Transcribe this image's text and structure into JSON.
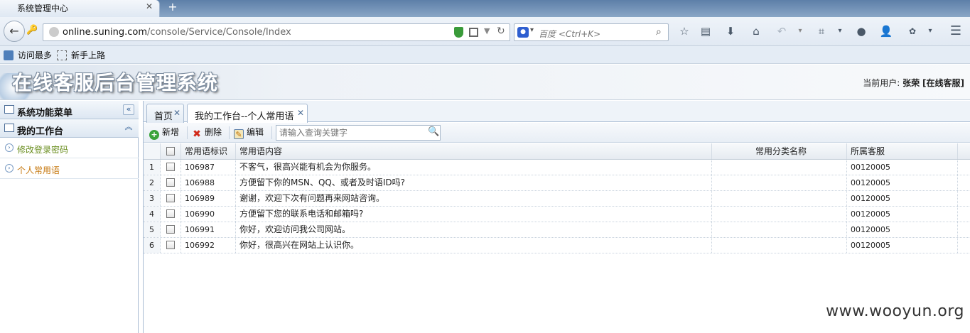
{
  "browser": {
    "tab_title": "系统管理中心",
    "url_domain": "online.suning.com",
    "url_path": "/console/Service/Console/Index",
    "search_placeholder": "百度 <Ctrl+K>"
  },
  "bookmarks": [
    {
      "label": "访问最多"
    },
    {
      "label": "新手上路"
    }
  ],
  "header": {
    "title": "在线客服后台管理系统",
    "user_label": "当前用户:",
    "user_name": "张荣",
    "user_role": "[在线客服]"
  },
  "sidebar": {
    "menu_title": "系统功能菜单",
    "group_title": "我的工作台",
    "items": [
      {
        "label": "修改登录密码",
        "color": "#6a8e1f"
      },
      {
        "label": "个人常用语",
        "color": "#c77a12"
      }
    ]
  },
  "tabs": [
    {
      "label": "首页"
    },
    {
      "label": "我的工作台--个人常用语"
    }
  ],
  "toolbar": {
    "add_label": "新增",
    "delete_label": "删除",
    "edit_label": "编辑",
    "query_placeholder": "请输入查询关键字"
  },
  "grid": {
    "columns": [
      "常用语标识",
      "常用语内容",
      "常用分类名称",
      "所属客服"
    ],
    "rows": [
      {
        "no": "1",
        "id": "106987",
        "content": "不客气，很高兴能有机会为你服务。",
        "category": "",
        "agent": "00120005"
      },
      {
        "no": "2",
        "id": "106988",
        "content": "方便留下你的MSN、QQ、或者及时语ID吗?",
        "category": "",
        "agent": "00120005"
      },
      {
        "no": "3",
        "id": "106989",
        "content": "谢谢，欢迎下次有问题再来网站咨询。",
        "category": "",
        "agent": "00120005"
      },
      {
        "no": "4",
        "id": "106990",
        "content": "方便留下您的联系电话和邮箱吗?",
        "category": "",
        "agent": "00120005"
      },
      {
        "no": "5",
        "id": "106991",
        "content": "你好，欢迎访问我公司网站。",
        "category": "",
        "agent": "00120005"
      },
      {
        "no": "6",
        "id": "106992",
        "content": "你好，很高兴在网站上认识你。",
        "category": "",
        "agent": "00120005"
      }
    ]
  },
  "watermark": "www.wooyun.org"
}
